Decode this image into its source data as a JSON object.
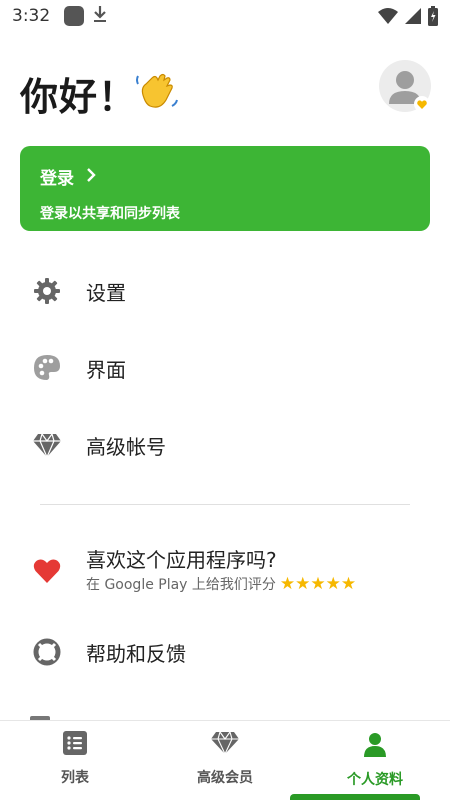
{
  "status_bar": {
    "time": "3:32"
  },
  "header": {
    "greeting": "你好！",
    "wave_emoji": "👋"
  },
  "login_card": {
    "title": "登录",
    "subtitle": "登录以共享和同步列表"
  },
  "menu": {
    "settings": "设置",
    "interface": "界面",
    "premium_account": "高级帐号",
    "rate_title": "喜欢这个应用程序吗?",
    "rate_subtitle": "在 Google Play 上给我们评分",
    "rate_stars": "★★★★★",
    "help": "帮助和反馈"
  },
  "bottom_nav": {
    "tabs": [
      {
        "label": "列表",
        "icon": "list-icon"
      },
      {
        "label": "高级会员",
        "icon": "diamond-icon"
      },
      {
        "label": "个人资料",
        "icon": "person-icon"
      }
    ],
    "active_index": 2
  },
  "colors": {
    "accent": "#3db535",
    "active_tab": "#2a9a26",
    "heart": "#e53935",
    "star": "#f6b800"
  }
}
